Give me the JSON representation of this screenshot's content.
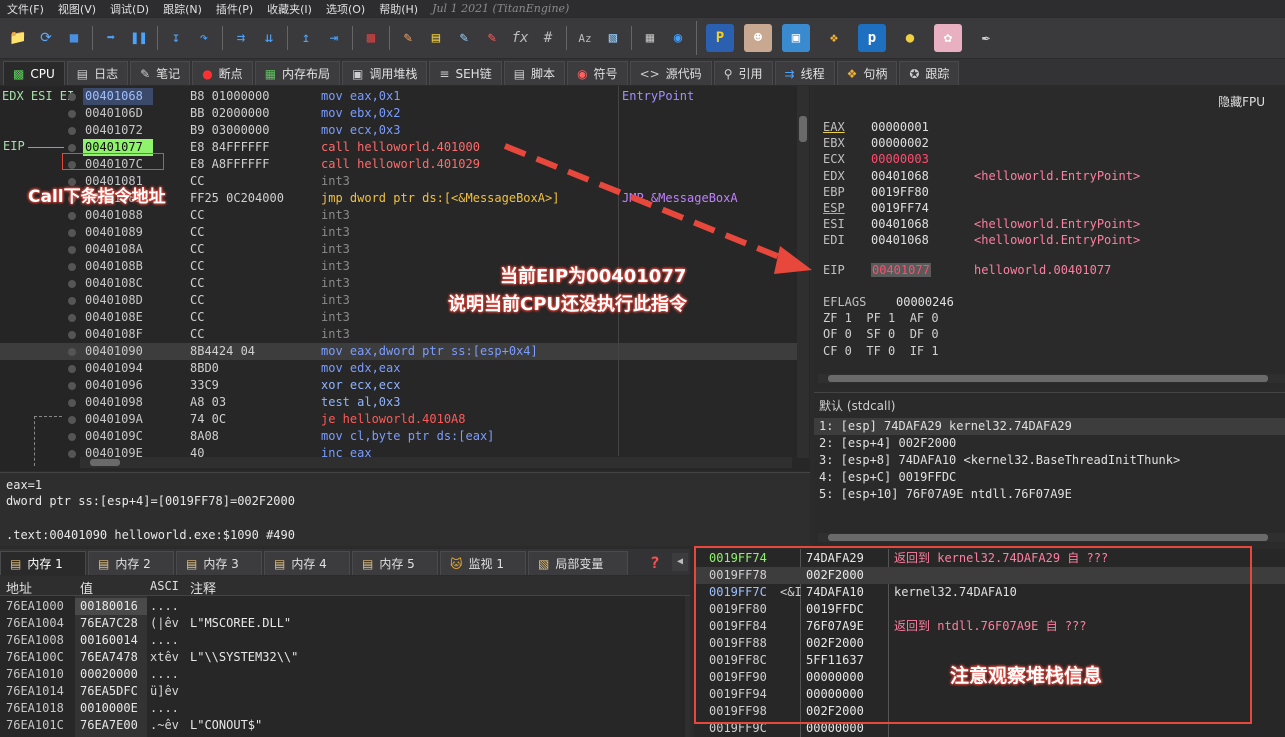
{
  "menu": [
    "文件(F)",
    "视图(V)",
    "调试(D)",
    "跟踪(N)",
    "插件(P)",
    "收藏夹(I)",
    "选项(O)",
    "帮助(H)"
  ],
  "version": "Jul 1 2021 (TitanEngine)",
  "tabs": [
    {
      "label": "CPU",
      "icon": "cpu-icon"
    },
    {
      "label": "日志",
      "icon": "log-icon"
    },
    {
      "label": "笔记",
      "icon": "notes-icon"
    },
    {
      "label": "断点",
      "icon": "breakpoint-icon"
    },
    {
      "label": "内存布局",
      "icon": "memory-map-icon"
    },
    {
      "label": "调用堆栈",
      "icon": "call-stack-icon"
    },
    {
      "label": "SEH链",
      "icon": "seh-icon"
    },
    {
      "label": "脚本",
      "icon": "script-icon"
    },
    {
      "label": "符号",
      "icon": "symbol-icon"
    },
    {
      "label": "源代码",
      "icon": "source-icon"
    },
    {
      "label": "引用",
      "icon": "references-icon"
    },
    {
      "label": "线程",
      "icon": "threads-icon"
    },
    {
      "label": "句柄",
      "icon": "handles-icon"
    },
    {
      "label": "跟踪",
      "icon": "trace-icon"
    }
  ],
  "cpu": {
    "side_label": "EDX ESI EI",
    "eip_label": "EIP",
    "rows": [
      {
        "addr": "00401068",
        "bytes": "B8 01000000",
        "asm": "mov eax,0x1",
        "cmt": "EntryPoint"
      },
      {
        "addr": "0040106D",
        "bytes": "BB 02000000",
        "asm": "mov ebx,0x2",
        "cmt": ""
      },
      {
        "addr": "00401072",
        "bytes": "B9 03000000",
        "asm": "mov ecx,0x3",
        "cmt": ""
      },
      {
        "addr": "00401077",
        "bytes": "E8 84FFFFFF",
        "asm": "call helloworld.401000",
        "cmt": ""
      },
      {
        "addr": "0040107C",
        "bytes": "E8 A8FFFFFF",
        "asm": "call helloworld.401029",
        "cmt": ""
      },
      {
        "addr": "00401081",
        "bytes": "CC",
        "asm": "int3",
        "cmt": ""
      },
      {
        "addr": "00401082",
        "bytes": "FF25 0C204000",
        "asm": "jmp dword ptr ds:[<&MessageBoxA>]",
        "cmt": "JMP.&MessageBoxA"
      },
      {
        "addr": "00401088",
        "bytes": "CC",
        "asm": "int3",
        "cmt": ""
      },
      {
        "addr": "00401089",
        "bytes": "CC",
        "asm": "int3",
        "cmt": ""
      },
      {
        "addr": "0040108A",
        "bytes": "CC",
        "asm": "int3",
        "cmt": ""
      },
      {
        "addr": "0040108B",
        "bytes": "CC",
        "asm": "int3",
        "cmt": ""
      },
      {
        "addr": "0040108C",
        "bytes": "CC",
        "asm": "int3",
        "cmt": ""
      },
      {
        "addr": "0040108D",
        "bytes": "CC",
        "asm": "int3",
        "cmt": ""
      },
      {
        "addr": "0040108E",
        "bytes": "CC",
        "asm": "int3",
        "cmt": ""
      },
      {
        "addr": "0040108F",
        "bytes": "CC",
        "asm": "int3",
        "cmt": ""
      },
      {
        "addr": "00401090",
        "bytes": "8B4424 04",
        "asm": "mov eax,dword ptr ss:[esp+0x4]",
        "cmt": ""
      },
      {
        "addr": "00401094",
        "bytes": "8BD0",
        "asm": "mov edx,eax",
        "cmt": ""
      },
      {
        "addr": "00401096",
        "bytes": "33C9",
        "asm": "xor ecx,ecx",
        "cmt": ""
      },
      {
        "addr": "00401098",
        "bytes": "A8 03",
        "asm": "test al,0x3",
        "cmt": ""
      },
      {
        "addr": "0040109A",
        "bytes": "74 0C",
        "asm": "je helloworld.4010A8",
        "cmt": ""
      },
      {
        "addr": "0040109C",
        "bytes": "8A08",
        "asm": "mov cl,byte ptr ds:[eax]",
        "cmt": ""
      },
      {
        "addr": "0040109E",
        "bytes": "40",
        "asm": "inc eax",
        "cmt": ""
      }
    ]
  },
  "info": {
    "line1": "eax=1",
    "line2": "dword ptr ss:[esp+4]=[0019FF78]=002F2000",
    "line3": ".text:00401090 helloworld.exe:$1090 #490"
  },
  "registers": {
    "hide_fpu": "隐藏FPU",
    "list": [
      {
        "name": "EAX",
        "val": "00000001",
        "note": "",
        "changed": false
      },
      {
        "name": "EBX",
        "val": "00000002",
        "note": "",
        "changed": false
      },
      {
        "name": "ECX",
        "val": "00000003",
        "note": "",
        "changed": true
      },
      {
        "name": "EDX",
        "val": "00401068",
        "note": "<helloworld.EntryPoint>",
        "changed": false
      },
      {
        "name": "EBP",
        "val": "0019FF80",
        "note": "",
        "changed": false
      },
      {
        "name": "ESP",
        "val": "0019FF74",
        "note": "",
        "changed": false
      },
      {
        "name": "ESI",
        "val": "00401068",
        "note": "<helloworld.EntryPoint>",
        "changed": false
      },
      {
        "name": "EDI",
        "val": "00401068",
        "note": "<helloworld.EntryPoint>",
        "changed": false
      }
    ],
    "eip": {
      "name": "EIP",
      "val": "00401077",
      "note": "helloworld.00401077"
    },
    "eflags": {
      "name": "EFLAGS",
      "val": "00000246"
    },
    "flags_line1": "ZF 1  PF 1  AF 0",
    "flags_line2": "OF 0  SF 0  DF 0",
    "flags_line3": "CF 0  TF 0  IF 1"
  },
  "args": {
    "title": "默认 (stdcall)",
    "lines": [
      "1: [esp] 74DAFA29 kernel32.74DAFA29",
      "2: [esp+4] 002F2000",
      "3: [esp+8] 74DAFA10 <kernel32.BaseThreadInitThunk>",
      "4: [esp+C] 0019FFDC",
      "5: [esp+10] 76F07A9E ntdll.76F07A9E"
    ]
  },
  "bottom_tabs": [
    "内存 1",
    "内存 2",
    "内存 3",
    "内存 4",
    "内存 5",
    "监视 1",
    "局部变量"
  ],
  "dump": {
    "headers": [
      "地址",
      "值",
      "ASCI",
      "注释"
    ],
    "rows": [
      {
        "addr": "76EA1000",
        "val": "00180016",
        "ascii": "....",
        "cmt": ""
      },
      {
        "addr": "76EA1004",
        "val": "76EA7C28",
        "ascii": "(|êv",
        "cmt": "L\"MSCOREE.DLL\""
      },
      {
        "addr": "76EA1008",
        "val": "00160014",
        "ascii": "....",
        "cmt": ""
      },
      {
        "addr": "76EA100C",
        "val": "76EA7478",
        "ascii": "xtêv",
        "cmt": "L\"\\\\SYSTEM32\\\\\""
      },
      {
        "addr": "76EA1010",
        "val": "00020000",
        "ascii": "....",
        "cmt": ""
      },
      {
        "addr": "76EA1014",
        "val": "76EA5DFC",
        "ascii": "ü]êv",
        "cmt": ""
      },
      {
        "addr": "76EA1018",
        "val": "0010000E",
        "ascii": "....",
        "cmt": ""
      },
      {
        "addr": "76EA101C",
        "val": "76EA7E00",
        "ascii": ".~êv",
        "cmt": "L\"CONOUT$\""
      }
    ]
  },
  "stack": {
    "rows": [
      {
        "addr": "0019FF74",
        "val": "74DAFA29",
        "cmt": "返回到 kernel32.74DAFA29 自 ???",
        "ret": true,
        "top": true
      },
      {
        "addr": "0019FF78",
        "val": "002F2000",
        "cmt": "",
        "ret": false,
        "top": false
      },
      {
        "addr": "0019FF7C",
        "val": "74DAFA10",
        "cmt": "kernel32.74DAFA10",
        "ret": false,
        "top": false,
        "tag": "<&I"
      },
      {
        "addr": "0019FF80",
        "val": "0019FFDC",
        "cmt": "",
        "ret": false,
        "top": false
      },
      {
        "addr": "0019FF84",
        "val": "76F07A9E",
        "cmt": "返回到 ntdll.76F07A9E 自 ???",
        "ret": true,
        "top": false
      },
      {
        "addr": "0019FF88",
        "val": "002F2000",
        "cmt": "",
        "ret": false,
        "top": false
      },
      {
        "addr": "0019FF8C",
        "val": "5FF11637",
        "cmt": "",
        "ret": false,
        "top": false
      },
      {
        "addr": "0019FF90",
        "val": "00000000",
        "cmt": "",
        "ret": false,
        "top": false
      },
      {
        "addr": "0019FF94",
        "val": "00000000",
        "cmt": "",
        "ret": false,
        "top": false
      },
      {
        "addr": "0019FF98",
        "val": "002F2000",
        "cmt": "",
        "ret": false,
        "top": false
      },
      {
        "addr": "0019FF9C",
        "val": "00000000",
        "cmt": "",
        "ret": false,
        "top": false
      }
    ]
  },
  "annotations": {
    "call_next": "Call下条指令地址",
    "eip_line1": "当前EIP为00401077",
    "eip_line2": "说明当前CPU还没执行此指令",
    "stack_note": "注意观察堆栈信息"
  },
  "colors": {
    "accent_red": "#e8483c",
    "eip_green": "#8ff36b",
    "asm_blue": "#7b9dff",
    "call_red": "#ff6b6b",
    "changed_red": "#ff4d6d",
    "ret_pink": "#ff7fa0"
  }
}
